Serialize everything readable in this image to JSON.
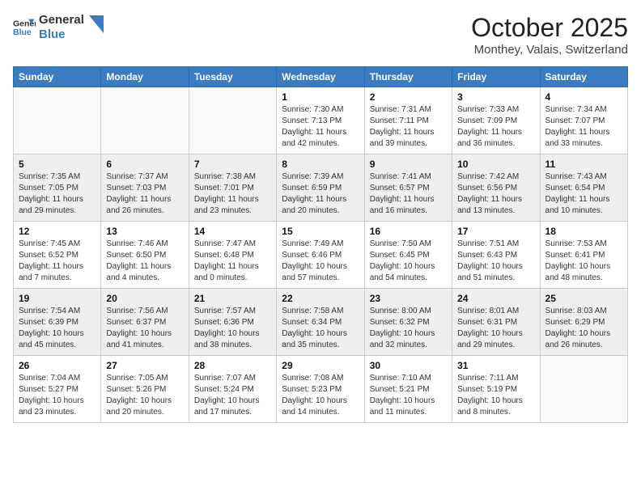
{
  "header": {
    "logo_line1": "General",
    "logo_line2": "Blue",
    "month": "October 2025",
    "location": "Monthey, Valais, Switzerland"
  },
  "weekdays": [
    "Sunday",
    "Monday",
    "Tuesday",
    "Wednesday",
    "Thursday",
    "Friday",
    "Saturday"
  ],
  "weeks": [
    [
      {
        "day": "",
        "info": ""
      },
      {
        "day": "",
        "info": ""
      },
      {
        "day": "",
        "info": ""
      },
      {
        "day": "1",
        "info": "Sunrise: 7:30 AM\nSunset: 7:13 PM\nDaylight: 11 hours\nand 42 minutes."
      },
      {
        "day": "2",
        "info": "Sunrise: 7:31 AM\nSunset: 7:11 PM\nDaylight: 11 hours\nand 39 minutes."
      },
      {
        "day": "3",
        "info": "Sunrise: 7:33 AM\nSunset: 7:09 PM\nDaylight: 11 hours\nand 36 minutes."
      },
      {
        "day": "4",
        "info": "Sunrise: 7:34 AM\nSunset: 7:07 PM\nDaylight: 11 hours\nand 33 minutes."
      }
    ],
    [
      {
        "day": "5",
        "info": "Sunrise: 7:35 AM\nSunset: 7:05 PM\nDaylight: 11 hours\nand 29 minutes."
      },
      {
        "day": "6",
        "info": "Sunrise: 7:37 AM\nSunset: 7:03 PM\nDaylight: 11 hours\nand 26 minutes."
      },
      {
        "day": "7",
        "info": "Sunrise: 7:38 AM\nSunset: 7:01 PM\nDaylight: 11 hours\nand 23 minutes."
      },
      {
        "day": "8",
        "info": "Sunrise: 7:39 AM\nSunset: 6:59 PM\nDaylight: 11 hours\nand 20 minutes."
      },
      {
        "day": "9",
        "info": "Sunrise: 7:41 AM\nSunset: 6:57 PM\nDaylight: 11 hours\nand 16 minutes."
      },
      {
        "day": "10",
        "info": "Sunrise: 7:42 AM\nSunset: 6:56 PM\nDaylight: 11 hours\nand 13 minutes."
      },
      {
        "day": "11",
        "info": "Sunrise: 7:43 AM\nSunset: 6:54 PM\nDaylight: 11 hours\nand 10 minutes."
      }
    ],
    [
      {
        "day": "12",
        "info": "Sunrise: 7:45 AM\nSunset: 6:52 PM\nDaylight: 11 hours\nand 7 minutes."
      },
      {
        "day": "13",
        "info": "Sunrise: 7:46 AM\nSunset: 6:50 PM\nDaylight: 11 hours\nand 4 minutes."
      },
      {
        "day": "14",
        "info": "Sunrise: 7:47 AM\nSunset: 6:48 PM\nDaylight: 11 hours\nand 0 minutes."
      },
      {
        "day": "15",
        "info": "Sunrise: 7:49 AM\nSunset: 6:46 PM\nDaylight: 10 hours\nand 57 minutes."
      },
      {
        "day": "16",
        "info": "Sunrise: 7:50 AM\nSunset: 6:45 PM\nDaylight: 10 hours\nand 54 minutes."
      },
      {
        "day": "17",
        "info": "Sunrise: 7:51 AM\nSunset: 6:43 PM\nDaylight: 10 hours\nand 51 minutes."
      },
      {
        "day": "18",
        "info": "Sunrise: 7:53 AM\nSunset: 6:41 PM\nDaylight: 10 hours\nand 48 minutes."
      }
    ],
    [
      {
        "day": "19",
        "info": "Sunrise: 7:54 AM\nSunset: 6:39 PM\nDaylight: 10 hours\nand 45 minutes."
      },
      {
        "day": "20",
        "info": "Sunrise: 7:56 AM\nSunset: 6:37 PM\nDaylight: 10 hours\nand 41 minutes."
      },
      {
        "day": "21",
        "info": "Sunrise: 7:57 AM\nSunset: 6:36 PM\nDaylight: 10 hours\nand 38 minutes."
      },
      {
        "day": "22",
        "info": "Sunrise: 7:58 AM\nSunset: 6:34 PM\nDaylight: 10 hours\nand 35 minutes."
      },
      {
        "day": "23",
        "info": "Sunrise: 8:00 AM\nSunset: 6:32 PM\nDaylight: 10 hours\nand 32 minutes."
      },
      {
        "day": "24",
        "info": "Sunrise: 8:01 AM\nSunset: 6:31 PM\nDaylight: 10 hours\nand 29 minutes."
      },
      {
        "day": "25",
        "info": "Sunrise: 8:03 AM\nSunset: 6:29 PM\nDaylight: 10 hours\nand 26 minutes."
      }
    ],
    [
      {
        "day": "26",
        "info": "Sunrise: 7:04 AM\nSunset: 5:27 PM\nDaylight: 10 hours\nand 23 minutes."
      },
      {
        "day": "27",
        "info": "Sunrise: 7:05 AM\nSunset: 5:26 PM\nDaylight: 10 hours\nand 20 minutes."
      },
      {
        "day": "28",
        "info": "Sunrise: 7:07 AM\nSunset: 5:24 PM\nDaylight: 10 hours\nand 17 minutes."
      },
      {
        "day": "29",
        "info": "Sunrise: 7:08 AM\nSunset: 5:23 PM\nDaylight: 10 hours\nand 14 minutes."
      },
      {
        "day": "30",
        "info": "Sunrise: 7:10 AM\nSunset: 5:21 PM\nDaylight: 10 hours\nand 11 minutes."
      },
      {
        "day": "31",
        "info": "Sunrise: 7:11 AM\nSunset: 5:19 PM\nDaylight: 10 hours\nand 8 minutes."
      },
      {
        "day": "",
        "info": ""
      }
    ]
  ]
}
